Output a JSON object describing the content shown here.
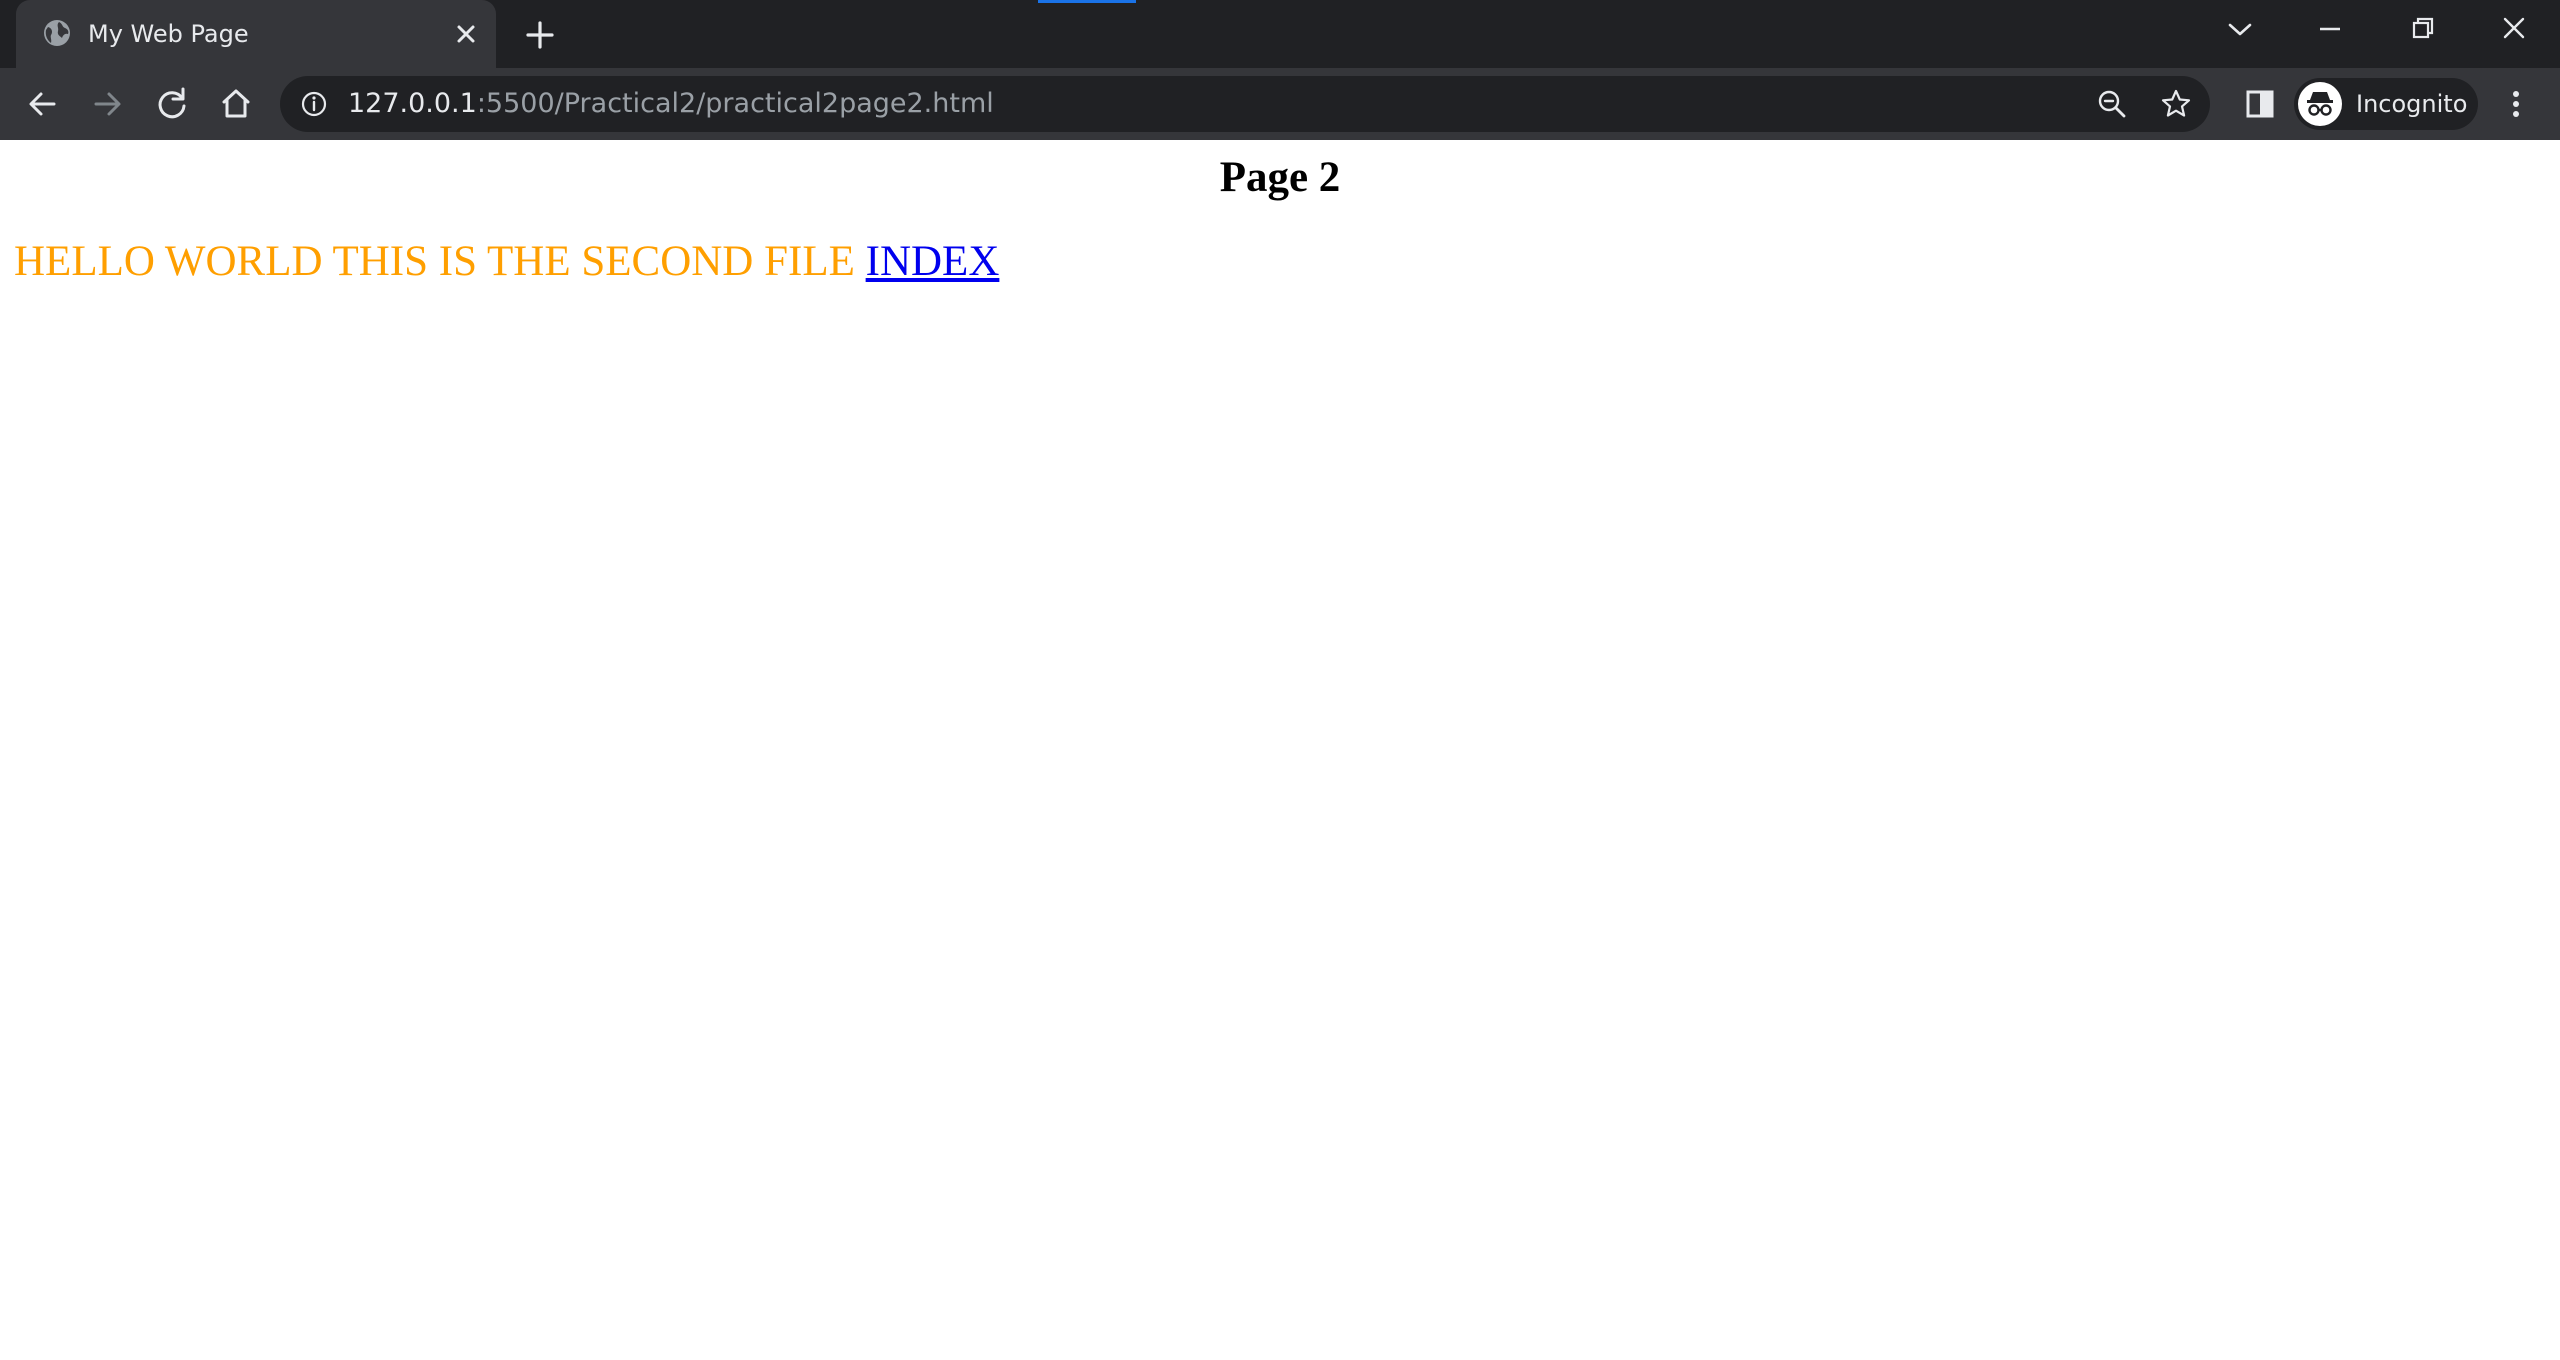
{
  "browser": {
    "tab": {
      "title": "My Web Page"
    },
    "address_bar": {
      "host": "127.0.0.1",
      "path": ":5500/Practical2/practical2page2.html"
    },
    "profile": {
      "label": "Incognito"
    },
    "colors": {
      "frame": "#202124",
      "toolbar": "#35363a",
      "loading_accent": "#1a73e8"
    },
    "icons": {
      "tab_favicon": "globe-icon",
      "tab_close": "close-icon",
      "new_tab": "plus-icon",
      "tab_search": "chevron-down-icon",
      "minimize": "minimize-icon",
      "restore": "restore-icon",
      "close_window": "close-icon",
      "back": "arrow-left-icon",
      "forward": "arrow-right-icon",
      "reload": "reload-icon",
      "home": "home-icon",
      "site_info": "info-icon",
      "zoom": "zoom-out-icon",
      "bookmark": "star-icon",
      "side_panel": "side-panel-icon",
      "incognito": "incognito-icon",
      "menu": "kebab-menu-icon"
    }
  },
  "page": {
    "heading": "Page 2",
    "paragraph_text": "HELLO WORLD THIS IS THE SECOND FILE",
    "link_text": "INDEX",
    "colors": {
      "paragraph_text": "#ff9f00",
      "link": "#0000ee"
    }
  }
}
